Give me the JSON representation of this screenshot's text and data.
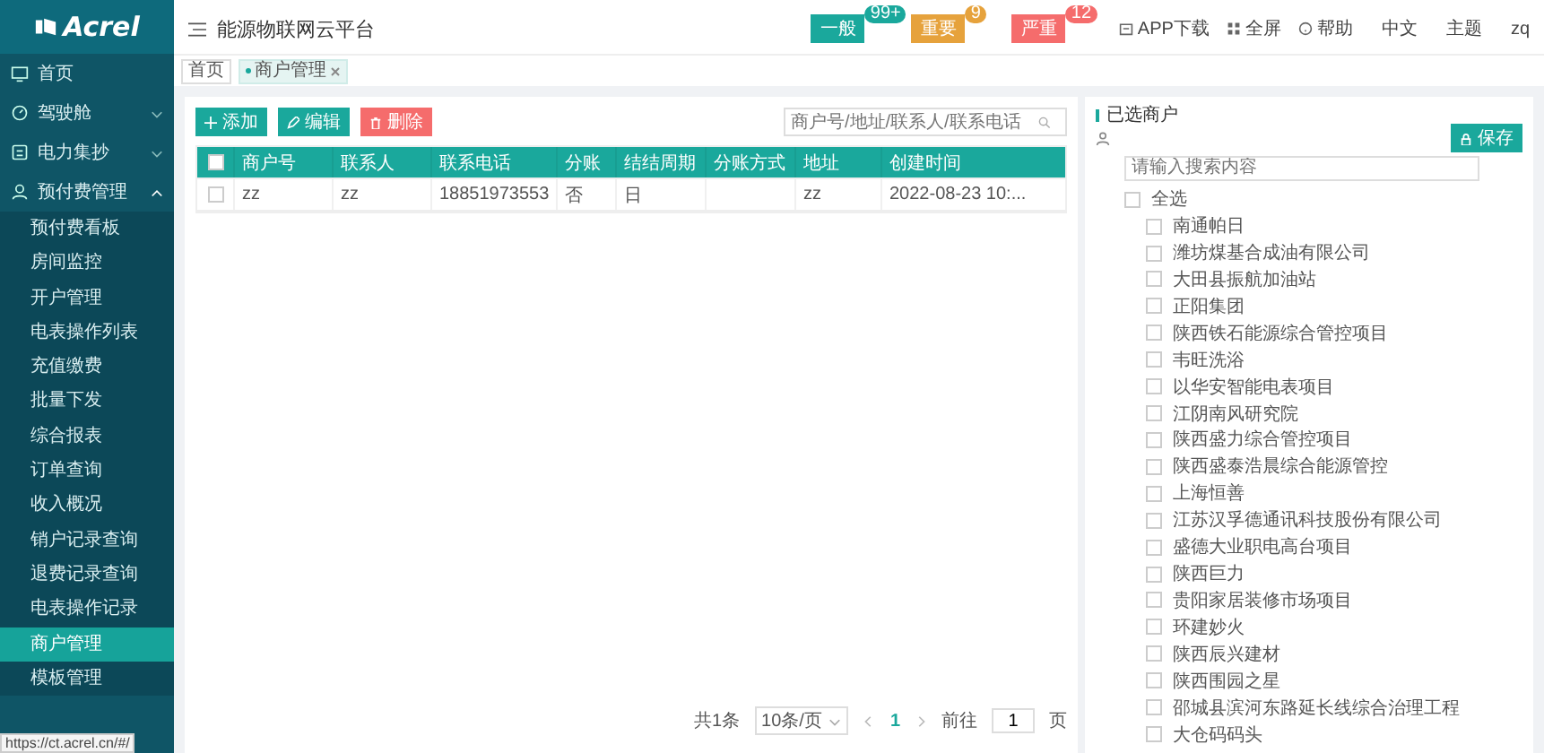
{
  "sidebar": {
    "logo": "Acrel",
    "items": [
      {
        "label": "首页"
      },
      {
        "label": "驾驶舱",
        "expanded": false
      },
      {
        "label": "电力集抄",
        "expanded": false
      },
      {
        "label": "预付费管理",
        "expanded": true,
        "children": [
          {
            "label": "预付费看板",
            "selected": false
          },
          {
            "label": "房间监控",
            "selected": false
          },
          {
            "label": "开户管理",
            "selected": false
          },
          {
            "label": "电表操作列表",
            "selected": false
          },
          {
            "label": "充值缴费",
            "selected": false
          },
          {
            "label": "批量下发",
            "selected": false
          },
          {
            "label": "综合报表",
            "selected": false
          },
          {
            "label": "订单查询",
            "selected": false
          },
          {
            "label": "收入概况",
            "selected": false
          },
          {
            "label": "销户记录查询",
            "selected": false
          },
          {
            "label": "退费记录查询",
            "selected": false
          },
          {
            "label": "电表操作记录",
            "selected": false
          },
          {
            "label": "商户管理",
            "selected": true
          },
          {
            "label": "模板管理",
            "selected": false
          }
        ]
      }
    ]
  },
  "status_url": "https://ct.acrel.cn/#/",
  "header": {
    "title": "能源物联网云平台",
    "alarms": [
      {
        "label": "一般",
        "count": "99+",
        "color": "#1aa89c"
      },
      {
        "label": "重要",
        "count": "9",
        "color": "#e6a23c"
      },
      {
        "label": "严重",
        "count": "12",
        "color": "#f56c6c"
      }
    ],
    "links": [
      "APP下载",
      "全屏",
      "帮助",
      "中文",
      "主题",
      "zq"
    ]
  },
  "tabs": [
    {
      "label": "首页",
      "selected": false
    },
    {
      "label": "商户管理",
      "selected": true
    }
  ],
  "toolbar": {
    "buttons": [
      {
        "label": "添加",
        "kind": "add"
      },
      {
        "label": "编辑",
        "kind": "edit"
      },
      {
        "label": "删除",
        "kind": "delete"
      }
    ],
    "search": {
      "placeholder": "商户号/地址/联系人/联系电话"
    }
  },
  "table": {
    "select_all": false,
    "columns": [
      "商户号",
      "联系人",
      "联系电话",
      "分账",
      "结结周期",
      "分账方式",
      "地址",
      "创建时间"
    ],
    "rows": [
      {
        "checked": false,
        "cells": [
          "zz",
          "zz",
          "18851973553",
          "否",
          "日",
          "",
          "zz",
          "2022-08-23 10:..."
        ]
      }
    ]
  },
  "pagination": {
    "total": "共1条",
    "page_size": "10条/页",
    "pages": [
      {
        "label": "1",
        "selected": true
      }
    ],
    "goto_label": "前往",
    "goto_value": "1",
    "goto_unit": "页"
  },
  "selected_panel": {
    "title": "已选商户",
    "save": "保存",
    "search": {
      "placeholder": "请输入搜索内容"
    },
    "tree": {
      "label": "全选",
      "checked": false,
      "children": [
        {
          "label": "南通帕日",
          "checked": false
        },
        {
          "label": "潍坊煤基合成油有限公司",
          "checked": false
        },
        {
          "label": "大田县振航加油站",
          "checked": false
        },
        {
          "label": "正阳集团",
          "checked": false
        },
        {
          "label": "陕西铁石能源综合管控项目",
          "checked": false
        },
        {
          "label": "韦旺洗浴",
          "checked": false
        },
        {
          "label": "以华安智能电表项目",
          "checked": false
        },
        {
          "label": "江阴南风研究院",
          "checked": false
        },
        {
          "label": "陕西盛力综合管控项目",
          "checked": false
        },
        {
          "label": "陕西盛泰浩晨综合能源管控",
          "checked": false
        },
        {
          "label": "上海恒善",
          "checked": false
        },
        {
          "label": "江苏汉孚德通讯科技股份有限公司",
          "checked": false
        },
        {
          "label": "盛德大业职电高台项目",
          "checked": false
        },
        {
          "label": "陕西巨力",
          "checked": false
        },
        {
          "label": "贵阳家居装修市场项目",
          "checked": false
        },
        {
          "label": "环建妙火",
          "checked": false
        },
        {
          "label": "陕西辰兴建材",
          "checked": false
        },
        {
          "label": "陕西围园之星",
          "checked": false
        },
        {
          "label": "邵城县滨河东路延长线综合治理工程",
          "checked": false
        },
        {
          "label": "大仓码码头",
          "checked": false
        }
      ]
    }
  }
}
